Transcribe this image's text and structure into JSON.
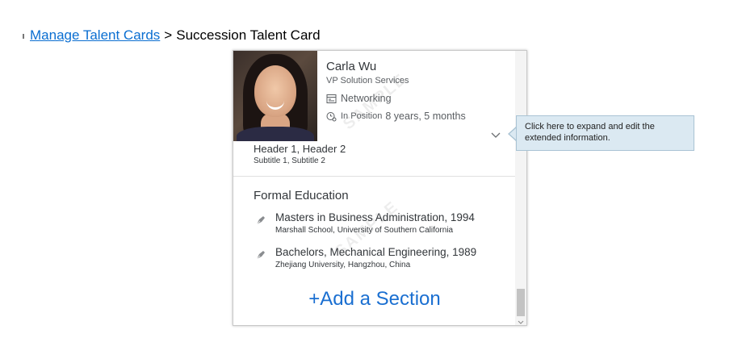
{
  "breadcrumb": {
    "link_label": "Manage Talent Cards",
    "separator": ">",
    "current": "Succession Talent Card"
  },
  "card": {
    "person_name": "Carla Wu",
    "person_title": "VP Solution Services",
    "networking_label": "Networking",
    "in_position_label": "In Position",
    "in_position_value": "8 years, 5 months",
    "watermark": "SAMPLE",
    "header": "Header 1, Header 2",
    "subtitle": "Subtitle 1, Subtitle 2",
    "section_title": "Formal Education",
    "education": [
      {
        "degree": "Masters in Business Administration, 1994",
        "school": "Marshall School, University of Southern California"
      },
      {
        "degree": "Bachelors, Mechanical Engineering, 1989",
        "school": "Zhejiang University, Hangzhou, China"
      }
    ],
    "add_section_label": "+Add a Section"
  },
  "tooltip": {
    "text": "Click here to expand and edit the extended information."
  },
  "colors": {
    "link": "#0a6ed1",
    "add_section": "#1a6fd1",
    "tooltip_bg": "#dbe9f2"
  }
}
